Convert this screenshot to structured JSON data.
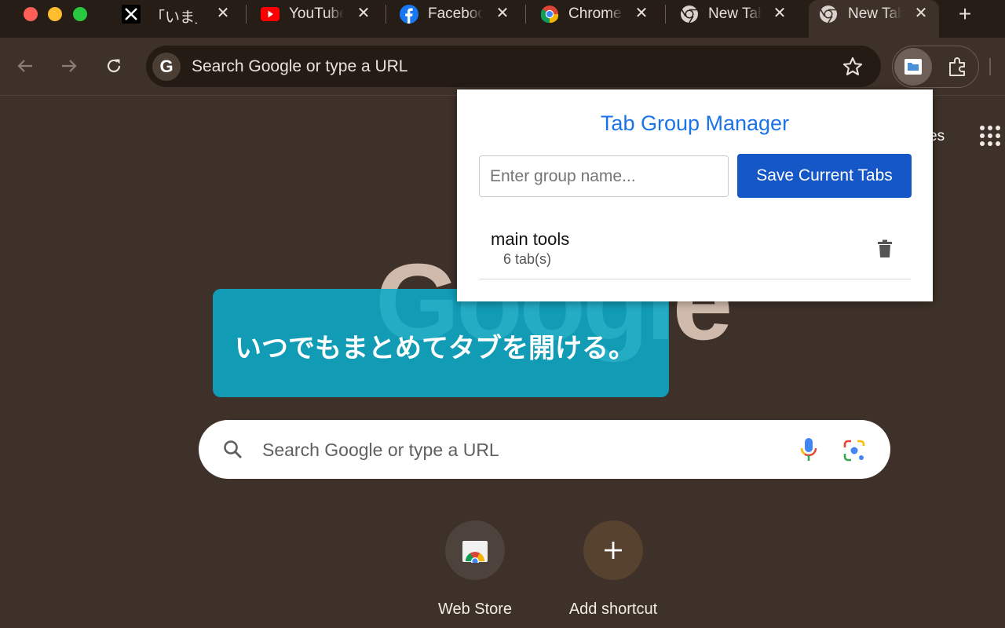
{
  "tabs": [
    {
      "title": "「いま」",
      "favicon": "x-logo-icon"
    },
    {
      "title": "YouTube",
      "favicon": "youtube-icon"
    },
    {
      "title": "Facebook",
      "favicon": "facebook-icon"
    },
    {
      "title": "Chrome",
      "favicon": "chrome-icon"
    },
    {
      "title": "New Tab",
      "favicon": "chromium-icon"
    },
    {
      "title": "New Tab",
      "favicon": "chromium-icon",
      "active": true
    }
  ],
  "toolbar": {
    "omnibox_text": "Search Google or type a URL",
    "omnibox_badge": "G"
  },
  "ntp": {
    "apps_partial_text": "es",
    "logo_text": "Google",
    "search_placeholder": "Search Google or type a URL",
    "shortcuts": [
      {
        "label": "Web Store",
        "icon": "web-store-icon"
      },
      {
        "label": "Add shortcut",
        "icon": "plus-icon"
      }
    ]
  },
  "banner": {
    "text": "いつでもまとめてタブを開ける。"
  },
  "popup": {
    "title": "Tab Group Manager",
    "input_placeholder": "Enter group name...",
    "input_value": "",
    "save_label": "Save Current Tabs",
    "groups": [
      {
        "name": "main tools",
        "count": "6 tab(s)"
      }
    ]
  },
  "colors": {
    "accent_blue": "#1a73e8",
    "save_button": "#1557c7",
    "banner": "#0caac8",
    "background": "#3d3129"
  }
}
